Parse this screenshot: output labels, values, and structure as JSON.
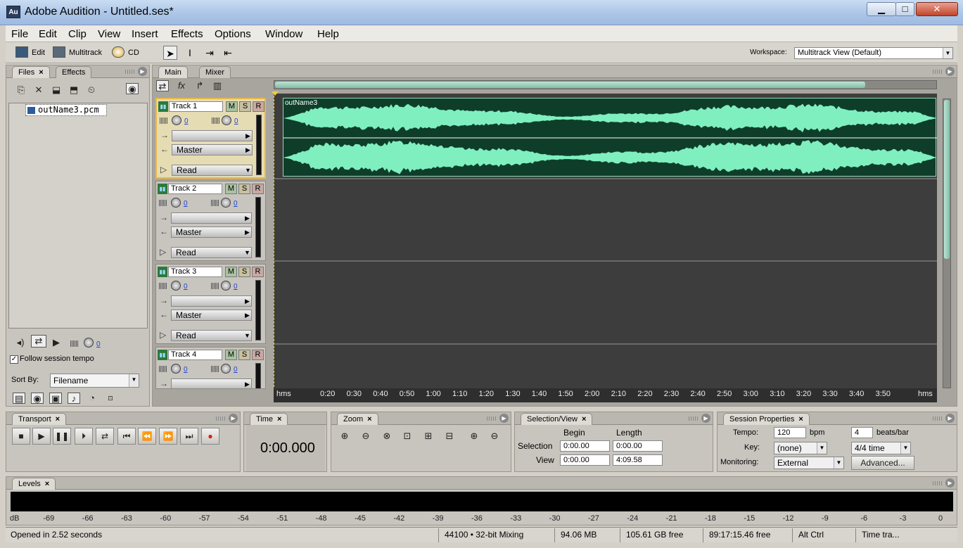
{
  "window": {
    "title": "Adobe Audition - Untitled.ses*",
    "app_icon": "Au"
  },
  "menu": [
    "File",
    "Edit",
    "Clip",
    "View",
    "Insert",
    "Effects",
    "Options",
    "Window",
    "Help"
  ],
  "toolbar": {
    "edit_label": "Edit",
    "multitrack_label": "Multitrack",
    "cd_label": "CD",
    "workspace_label": "Workspace:",
    "workspace_value": "Multitrack View (Default)"
  },
  "files_panel": {
    "tabs": [
      "Files",
      "Effects"
    ],
    "file": "outName3.pcm",
    "follow_tempo": "Follow session tempo",
    "volume_value": "0",
    "sort_by_label": "Sort By:",
    "sort_by_value": "Filename"
  },
  "main_panel": {
    "tabs": [
      "Main",
      "Mixer"
    ]
  },
  "tracks": [
    {
      "name": "Track 1",
      "vol": "0",
      "pan": "0",
      "output": "Master",
      "automation": "Read"
    },
    {
      "name": "Track 2",
      "vol": "0",
      "pan": "0",
      "output": "Master",
      "automation": "Read"
    },
    {
      "name": "Track 3",
      "vol": "0",
      "pan": "0",
      "output": "Master",
      "automation": "Read"
    },
    {
      "name": "Track 4",
      "vol": "0",
      "pan": "0"
    }
  ],
  "msr": {
    "m": "M",
    "s": "S",
    "r": "R"
  },
  "clip": {
    "name": "outName3"
  },
  "timeline": {
    "start": "hms",
    "end": "hms",
    "ticks": [
      "0:20",
      "0:30",
      "0:40",
      "0:50",
      "1:00",
      "1:10",
      "1:20",
      "1:30",
      "1:40",
      "1:50",
      "2:00",
      "2:10",
      "2:20",
      "2:30",
      "2:40",
      "2:50",
      "3:00",
      "3:10",
      "3:20",
      "3:30",
      "3:40",
      "3:50"
    ]
  },
  "transport": {
    "tab": "Transport"
  },
  "time": {
    "tab": "Time",
    "value": "0:00.000"
  },
  "zoom": {
    "tab": "Zoom"
  },
  "selection": {
    "tab": "Selection/View",
    "begin_label": "Begin",
    "length_label": "Length",
    "selection_label": "Selection",
    "view_label": "View",
    "sel_begin": "0:00.00",
    "sel_length": "0:00.00",
    "view_begin": "0:00.00",
    "view_length": "4:09.58"
  },
  "session": {
    "tab": "Session Properties",
    "tempo_label": "Tempo:",
    "tempo": "120",
    "bpm": "bpm",
    "beats": "4",
    "beats_label": "beats/bar",
    "key_label": "Key:",
    "key": "(none)",
    "time_sig": "4/4 time",
    "monitoring_label": "Monitoring:",
    "monitoring": "External",
    "advanced": "Advanced..."
  },
  "levels": {
    "tab": "Levels",
    "scale": [
      "dB",
      "-69",
      "-66",
      "-63",
      "-60",
      "-57",
      "-54",
      "-51",
      "-48",
      "-45",
      "-42",
      "-39",
      "-36",
      "-33",
      "-30",
      "-27",
      "-24",
      "-21",
      "-18",
      "-15",
      "-12",
      "-9",
      "-6",
      "-3",
      "0"
    ]
  },
  "status": {
    "message": "Opened in 2.52 seconds",
    "format": "44100 • 32-bit Mixing",
    "mem": "94.06 MB",
    "disk": "105.61 GB free",
    "time_free": "89:17:15.46 free",
    "ctrl": "Alt Ctrl",
    "track": "Time tra..."
  }
}
